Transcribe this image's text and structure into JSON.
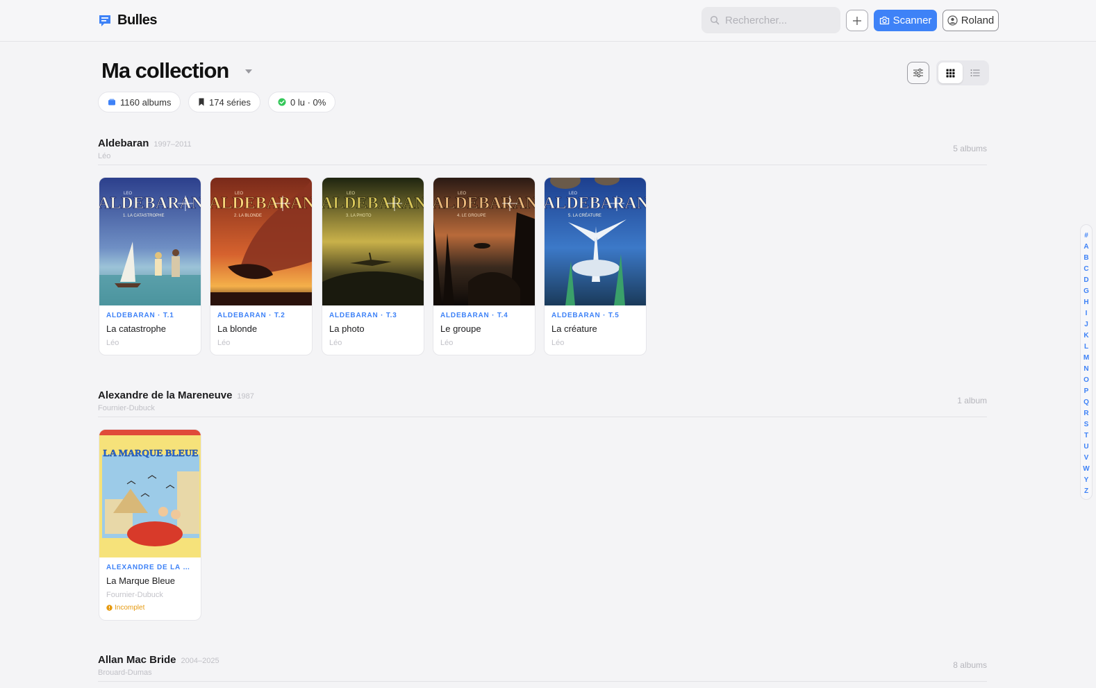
{
  "app": {
    "name": "Bulles"
  },
  "topbar": {
    "search_placeholder": "Rechercher...",
    "scan_label": "Scanner",
    "user_label": "Roland"
  },
  "page": {
    "title": "Ma collection",
    "stats": {
      "albums": "1160 albums",
      "series": "174 séries",
      "read": "0 lu · 0%"
    }
  },
  "sections": [
    {
      "name": "Aldebaran",
      "years": "1997–2011",
      "author": "Léo",
      "count": "5 albums",
      "albums": [
        {
          "series": "ALDEBARAN · T.1",
          "title": "La catastrophe",
          "author": "Léo",
          "cover_text": "1. LA CATASTROPHE"
        },
        {
          "series": "ALDEBARAN · T.2",
          "title": "La blonde",
          "author": "Léo",
          "cover_text": "2. LA BLONDE"
        },
        {
          "series": "ALDEBARAN · T.3",
          "title": "La photo",
          "author": "Léo",
          "cover_text": "3. LA PHOTO"
        },
        {
          "series": "ALDEBARAN · T.4",
          "title": "Le groupe",
          "author": "Léo",
          "cover_text": "4. LE GROUPE"
        },
        {
          "series": "ALDEBARAN · T.5",
          "title": "La créature",
          "author": "Léo",
          "cover_text": "5. LA CRÉATURE"
        }
      ]
    },
    {
      "name": "Alexandre de la Mareneuve",
      "years": "1987",
      "author": "Fournier-Dubuck",
      "count": "1 album",
      "albums": [
        {
          "series": "ALEXANDRE DE LA MARENEUVE",
          "title": "La Marque Bleue",
          "author": "Fournier-Dubuck",
          "status": "Incomplet",
          "cover_text": "LA MARQUE BLEUE"
        }
      ]
    },
    {
      "name": "Allan Mac Bride",
      "years": "2004–2025",
      "author": "Brouard-Dumas",
      "count": "8 albums"
    }
  ],
  "cover_logo_text": "ALDEBARAN",
  "cover_author_text": "LEO",
  "alphabet": [
    "#",
    "A",
    "B",
    "C",
    "D",
    "G",
    "H",
    "I",
    "J",
    "K",
    "L",
    "M",
    "N",
    "O",
    "P",
    "Q",
    "R",
    "S",
    "T",
    "U",
    "V",
    "W",
    "Y",
    "Z"
  ],
  "colors": {
    "accent": "#3e82f7",
    "warning": "#e69a10",
    "read": "#34c759"
  }
}
